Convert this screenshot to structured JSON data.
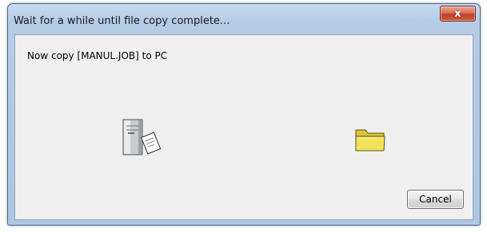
{
  "dialog": {
    "title": "Wait for a while until file copy complete...",
    "close_label": "x",
    "message": "Now copy [MANUL.JOB] to PC",
    "cancel_label": "Cancel"
  },
  "icons": {
    "source": "pc-tower-icon",
    "destination": "folder-icon",
    "close": "close-icon"
  },
  "colors": {
    "titlebar": "#b6cce6",
    "close_button": "#c2412a",
    "client_background": "#f0f0f0",
    "folder": "#f2e25a"
  }
}
